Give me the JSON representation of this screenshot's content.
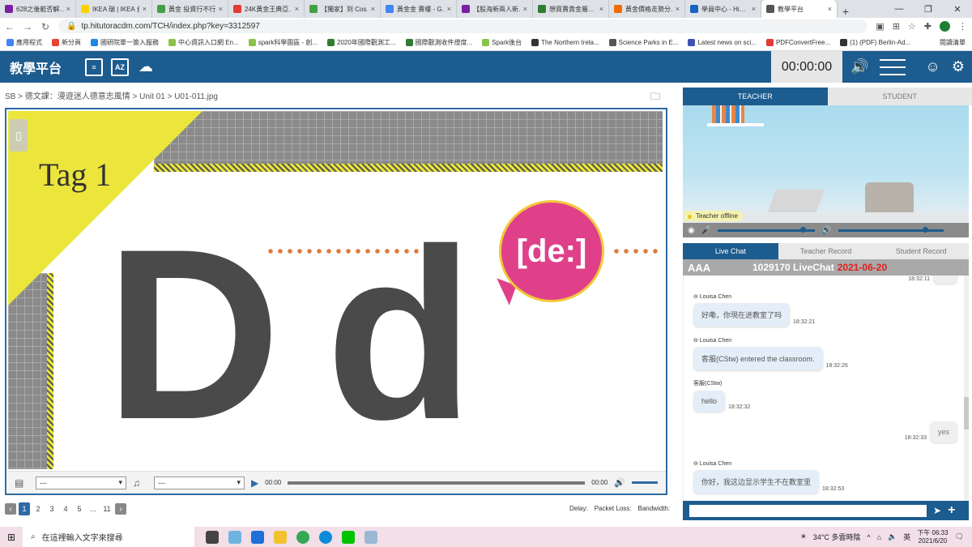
{
  "browser": {
    "tabs": [
      {
        "title": "628之後能否解…",
        "color": "#7b1fa2"
      },
      {
        "title": "IKEA 瑞 | IKEA 台…",
        "color": "#ffd200"
      },
      {
        "title": "黃金 投資行不行",
        "color": "#43a047"
      },
      {
        "title": "24K黃金王典亞…",
        "color": "#e53935"
      },
      {
        "title": "【獨家】到 Cos…",
        "color": "#43a047"
      },
      {
        "title": "黃金金 賣樓 - G…",
        "color": "#4285f4"
      },
      {
        "title": "【股海新兩人新…",
        "color": "#7b1fa2"
      },
      {
        "title": "想買賣貴金屬…",
        "color": "#2e7d32"
      },
      {
        "title": "黃金價格走勢分…",
        "color": "#ef6c00"
      },
      {
        "title": "學員中心 - Hi…",
        "color": "#1565c0"
      },
      {
        "title": "教學平台",
        "color": "#555555"
      }
    ],
    "new_tab": "+",
    "url": "tp.hitutoracdm.com/TCH/index.php?key=3312597",
    "bookmarks": [
      {
        "label": "應用程式",
        "color": "#4285f4"
      },
      {
        "label": "新分頁",
        "color": "#ea4335"
      },
      {
        "label": "國研院單一簽入服務",
        "color": "#1e88e5"
      },
      {
        "label": "中心資訊入口網 En...",
        "color": "#8bc34a"
      },
      {
        "label": "spark科學園區 - 創...",
        "color": "#8bc34a"
      },
      {
        "label": "2020年國際觀測工...",
        "color": "#2e7d32"
      },
      {
        "label": "國際觀測收件燈度...",
        "color": "#2e7d32"
      },
      {
        "label": "Spark後台",
        "color": "#8bc34a"
      },
      {
        "label": "The Northern Irela...",
        "color": "#333333"
      },
      {
        "label": "Science Parks in E...",
        "color": "#555555"
      },
      {
        "label": "Latest news on sci...",
        "color": "#3f51b5"
      },
      {
        "label": "PDFConvertFree...",
        "color": "#e53935"
      },
      {
        "label": "(1) (PDF) Berlin-Ad...",
        "color": "#333333"
      }
    ],
    "reading_list": "閱讀清單"
  },
  "app": {
    "brand": "教學平台",
    "timer": "00:00:00",
    "header_icons": [
      "document-icon",
      "az-list-icon",
      "cloud-upload-icon"
    ]
  },
  "breadcrumb": "SB > 德文課：漫遊迷人德意志風情 > Unit 01 > U01-011.jpg",
  "lesson": {
    "tag": "Tag 1",
    "big_letter": "D",
    "small_letter": "d",
    "phonetic": "[de:]"
  },
  "player": {
    "select1": "---",
    "select2": "---",
    "time_start": "00:00",
    "time_end": "00:00",
    "progress": 0,
    "volume": 1
  },
  "pager": {
    "pages": [
      "1",
      "2",
      "3",
      "4",
      "5",
      "...",
      "11"
    ],
    "current": "1"
  },
  "netstats": {
    "delay": "Delay:",
    "packet_loss": "Packet Loss:",
    "bandwidth": "Bandwidth:"
  },
  "right": {
    "video_tabs": [
      "TEACHER",
      "STUDENT"
    ],
    "teacher_status": "Teacher offline",
    "mic_level": 0.85,
    "speaker_level": 0.8,
    "chat_tabs": [
      "Live Chat",
      "Teacher Record",
      "Student Record"
    ],
    "font_sizes": "AAA",
    "chat_title": "1029170 LiveChat",
    "chat_date": "2021-06-20",
    "messages": [
      {
        "sender": "",
        "text": "",
        "time": "18:32:11",
        "side": "right"
      },
      {
        "sender": "⊖ Louisa Chen",
        "text": "好嘞，你現在进教室了吗",
        "time": "18:32:21",
        "side": "left"
      },
      {
        "sender": "⊖ Louisa Chen",
        "text": "客服(CStw) entered the classroom.",
        "time": "18:32:26",
        "side": "left"
      },
      {
        "sender": "客服(CStw)",
        "text": "hello",
        "time": "18:32:32",
        "side": "left"
      },
      {
        "sender": "",
        "text": "yes",
        "time": "18:32:33",
        "side": "right"
      },
      {
        "sender": "⊖ Louisa Chen",
        "text": "你好，我这边显示学生不在教室里",
        "time": "18:32:53",
        "side": "left"
      }
    ]
  },
  "taskbar": {
    "search_placeholder": "在這裡輸入文字來搜尋",
    "weather": "34°C 多雲時陰",
    "ime": "英",
    "time": "下午 06:33",
    "date": "2021/6/20"
  }
}
